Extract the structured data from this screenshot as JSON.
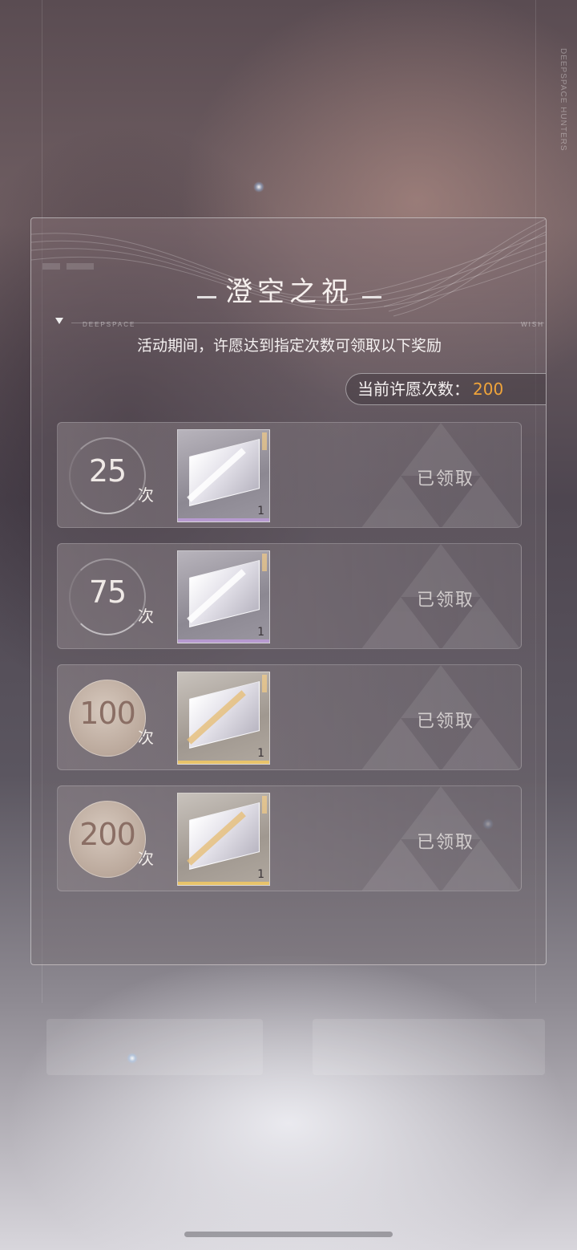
{
  "background": {
    "brand_vertical": "DEEPSPACE HUNTERS"
  },
  "panel": {
    "title": "澄空之祝",
    "sub_left": "DEEPSPACE",
    "sub_right": "WISH",
    "description": "活动期间，许愿达到指定次数可领取以下奖励",
    "count_label": "当前许愿次数：",
    "count_value": "200"
  },
  "rewards": [
    {
      "milestone": "25",
      "unit": "次",
      "quantity": "1",
      "status": "已领取",
      "rarity": "purple"
    },
    {
      "milestone": "75",
      "unit": "次",
      "quantity": "1",
      "status": "已领取",
      "rarity": "purple"
    },
    {
      "milestone": "100",
      "unit": "次",
      "quantity": "1",
      "status": "已领取",
      "rarity": "gold"
    },
    {
      "milestone": "200",
      "unit": "次",
      "quantity": "1",
      "status": "已领取",
      "rarity": "gold"
    }
  ],
  "colors": {
    "accent_count": "#f0a43a",
    "rarity_purple": "#b79ad0",
    "rarity_gold": "#e8c36a"
  }
}
